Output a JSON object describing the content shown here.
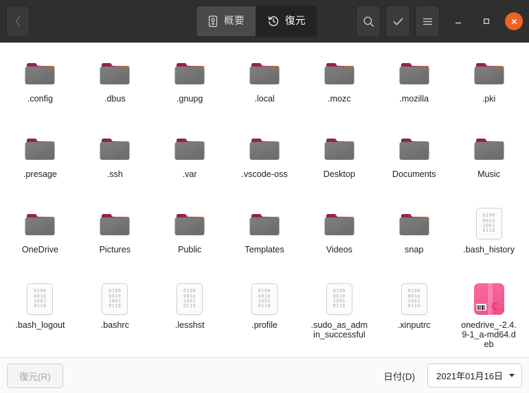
{
  "window": {
    "titlebar": {
      "back_button": {
        "icon": "chevron-left-icon",
        "enabled": false
      },
      "tabs": [
        {
          "id": "overview",
          "label": "概要",
          "icon": "drive-icon",
          "active": false
        },
        {
          "id": "restore",
          "label": "復元",
          "icon": "history-clock-icon",
          "active": true
        }
      ],
      "actions": [
        {
          "id": "search",
          "icon": "search-icon"
        },
        {
          "id": "select",
          "icon": "check-icon"
        },
        {
          "id": "menu",
          "icon": "hamburger-menu-icon"
        }
      ],
      "window_controls": [
        {
          "id": "minimize",
          "icon": "minimize-icon",
          "glyph": "–"
        },
        {
          "id": "maximize",
          "icon": "maximize-icon",
          "glyph": "□"
        },
        {
          "id": "close",
          "icon": "close-icon",
          "glyph": "×"
        }
      ],
      "colors": {
        "bar_background": "#2f2f2f",
        "active_tab_background": "#232323",
        "close_button": "#f06124"
      }
    }
  },
  "file_browser": {
    "columns": 7,
    "items": [
      {
        "name": ".config",
        "icon": "folder-icon"
      },
      {
        "name": ".dbus",
        "icon": "folder-icon"
      },
      {
        "name": ".gnupg",
        "icon": "folder-icon"
      },
      {
        "name": ".local",
        "icon": "folder-icon"
      },
      {
        "name": ".mozc",
        "icon": "folder-icon"
      },
      {
        "name": ".mozilla",
        "icon": "folder-icon"
      },
      {
        "name": ".pki",
        "icon": "folder-icon"
      },
      {
        "name": ".presage",
        "icon": "folder-icon"
      },
      {
        "name": ".ssh",
        "icon": "folder-icon"
      },
      {
        "name": ".var",
        "icon": "folder-icon"
      },
      {
        "name": ".vscode-oss",
        "icon": "folder-icon"
      },
      {
        "name": "Desktop",
        "icon": "folder-icon"
      },
      {
        "name": "Documents",
        "icon": "folder-icon"
      },
      {
        "name": "Music",
        "icon": "folder-icon"
      },
      {
        "name": "OneDrive",
        "icon": "folder-icon"
      },
      {
        "name": "Pictures",
        "icon": "folder-icon"
      },
      {
        "name": "Public",
        "icon": "folder-icon"
      },
      {
        "name": "Templates",
        "icon": "folder-icon"
      },
      {
        "name": "Videos",
        "icon": "folder-icon"
      },
      {
        "name": "snap",
        "icon": "folder-icon"
      },
      {
        "name": ".bash_history",
        "icon": "binary-file-icon"
      },
      {
        "name": ".bash_logout",
        "icon": "binary-file-icon"
      },
      {
        "name": ".bashrc",
        "icon": "binary-file-icon"
      },
      {
        "name": ".lesshst",
        "icon": "binary-file-icon"
      },
      {
        "name": ".profile",
        "icon": "binary-file-icon"
      },
      {
        "name": ".sudo_as_admin_successful",
        "icon": "binary-file-icon"
      },
      {
        "name": ".xinputrc",
        "icon": "binary-file-icon"
      },
      {
        "name": "onedrive_-2.4.9-1_a-md64.deb",
        "icon": "deb-package-icon"
      }
    ],
    "binary_icon_rows": [
      "0100",
      "0010",
      "1001",
      "0110"
    ]
  },
  "action_bar": {
    "restore_button": {
      "label": "復元(R)",
      "enabled": false
    },
    "date_label": "日付(D)",
    "date_value": "2021年01月16日",
    "date_caret": "chevron-down-icon"
  }
}
